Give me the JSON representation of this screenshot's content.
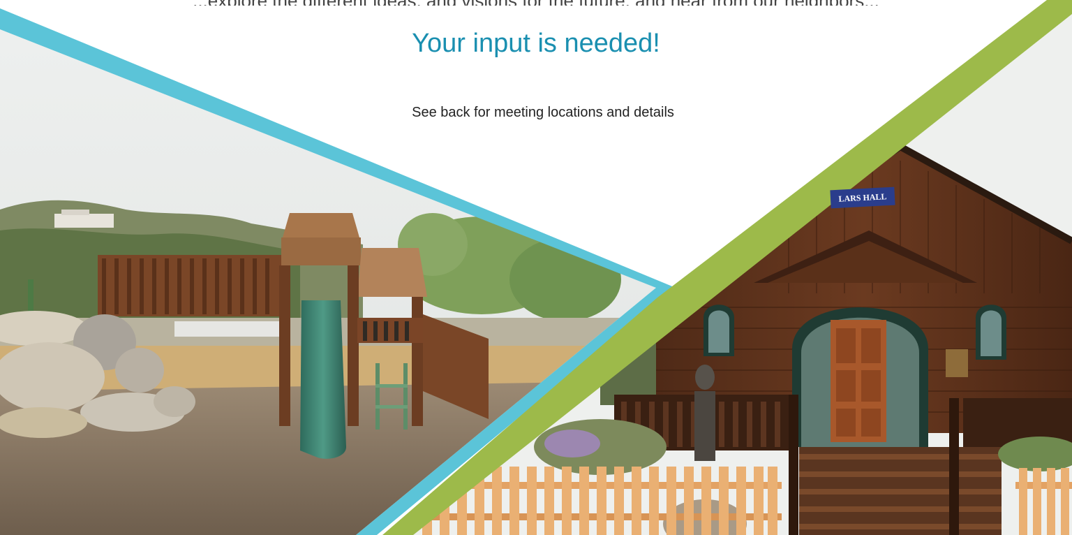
{
  "flyer": {
    "cut_off_line": "...explore the different ideas, and visions for the future, and hear from our neighbors...",
    "headline": "Your input is needed!",
    "subheadline": "See back for meeting locations and details"
  },
  "photos": {
    "left": {
      "subject": "playground-with-slide-and-boulders"
    },
    "right": {
      "subject": "wooden-hall-with-arched-doorway",
      "sign_text": "LARS HALL"
    }
  },
  "colors": {
    "accent_blue": "#5bc4d8",
    "accent_green": "#9dba4a",
    "headline_blue": "#1a8fb0",
    "text_dark": "#222222"
  }
}
